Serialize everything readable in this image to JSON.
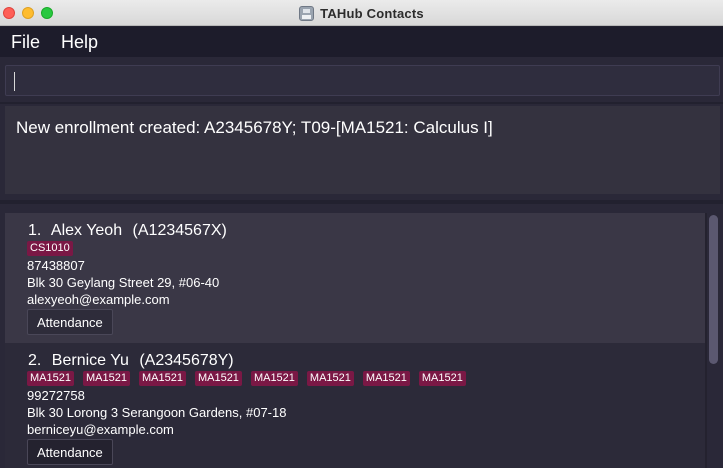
{
  "window": {
    "title": "TAHub Contacts"
  },
  "menu": {
    "items": [
      "File",
      "Help"
    ]
  },
  "command_box": {
    "value": ""
  },
  "result": {
    "message": "New enrollment created: A2345678Y; T09-[MA1521: Calculus I]"
  },
  "persons": [
    {
      "index": "1.",
      "name": "Alex Yeoh",
      "matric": "(A1234567X)",
      "tags": [
        "CS1010"
      ],
      "phone": "87438807",
      "address": "Blk 30 Geylang Street 29, #06-40",
      "email": "alexyeoh@example.com",
      "button_label": "Attendance"
    },
    {
      "index": "2.",
      "name": "Bernice Yu",
      "matric": "(A2345678Y)",
      "tags": [
        "MA1521",
        "MA1521",
        "MA1521",
        "MA1521",
        "MA1521",
        "MA1521",
        "MA1521",
        "MA1521"
      ],
      "phone": "99272758",
      "address": "Blk 30 Lorong 3 Serangoon Gardens, #07-18",
      "email": "berniceyu@example.com",
      "button_label": "Attendance"
    }
  ],
  "colors": {
    "background": "#22212f",
    "panel": "#34323f",
    "tag": "#7a1845",
    "selected_card": "#3a3746"
  },
  "icons": {
    "window_controls": [
      "close-icon",
      "minimize-icon",
      "zoom-icon"
    ],
    "app_icon": "floppy-disk-icon"
  }
}
